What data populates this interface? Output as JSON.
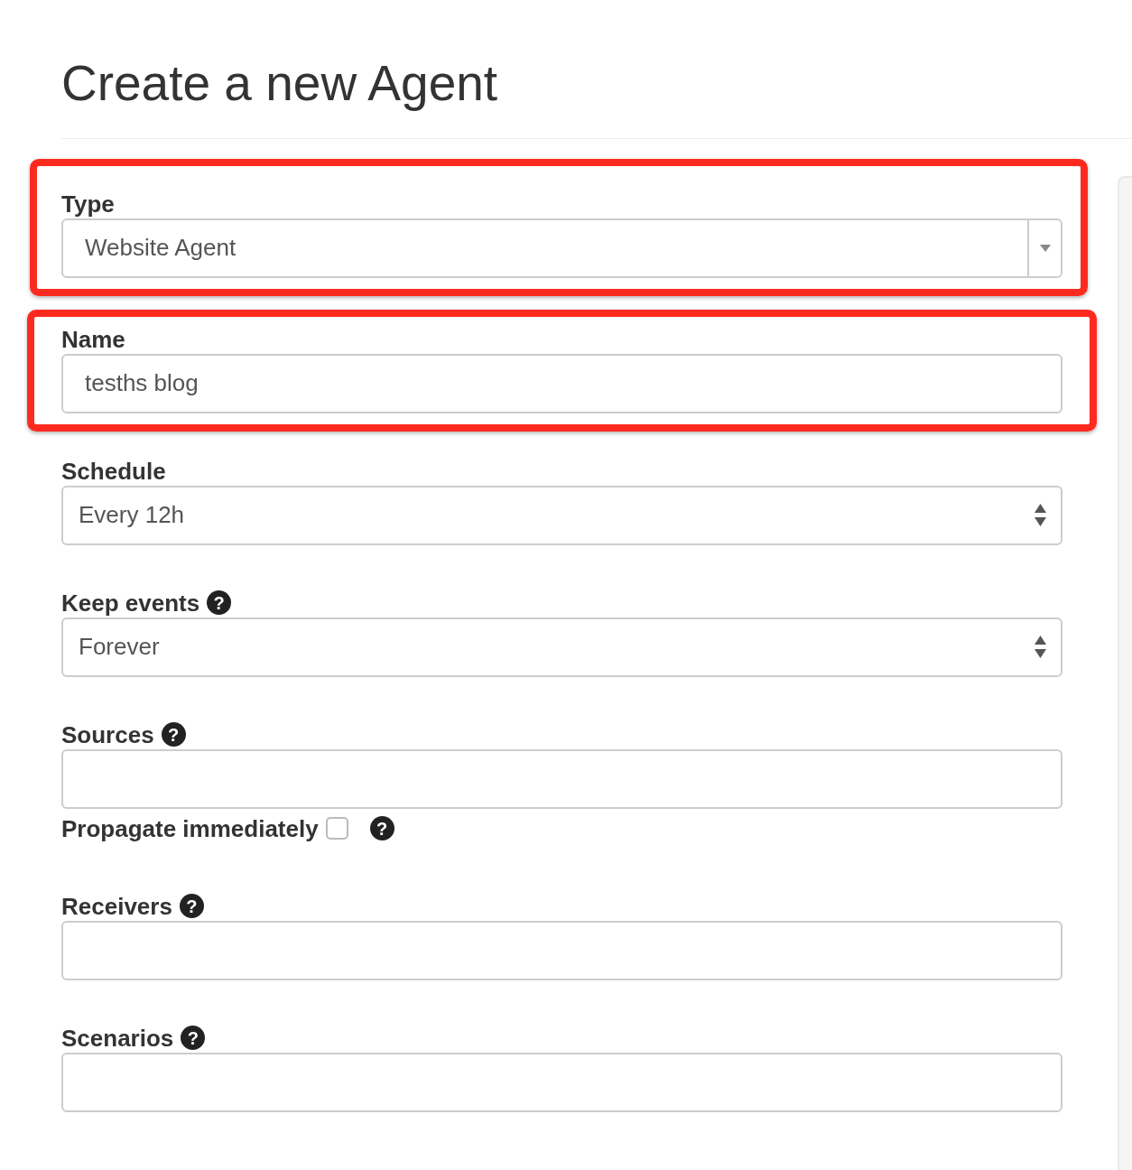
{
  "title": "Create a new Agent",
  "fields": [
    {
      "label": "Type",
      "kind": "combo",
      "value": "Website Agent",
      "highlighted": true
    },
    {
      "label": "Name",
      "kind": "text",
      "value": "tesths blog",
      "highlighted": true
    },
    {
      "label": "Schedule",
      "kind": "select",
      "value": "Every 12h"
    },
    {
      "label": "Keep events",
      "help": "?",
      "kind": "select",
      "value": "Forever"
    },
    {
      "label": "Sources",
      "help": "?",
      "kind": "text",
      "option": {
        "label": "Propagate immediately",
        "checked": false,
        "help": "?"
      }
    },
    {
      "label": "Receivers",
      "help": "?",
      "kind": "text"
    },
    {
      "label": "Scenarios",
      "help": "?",
      "kind": "text"
    }
  ]
}
